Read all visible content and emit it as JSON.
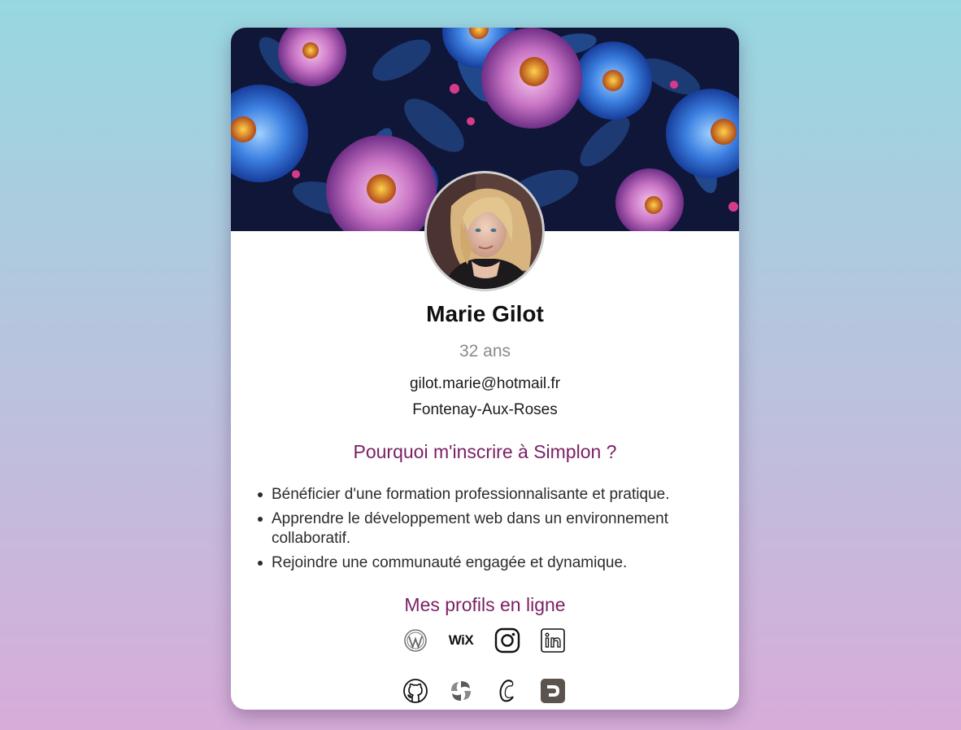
{
  "profile": {
    "name": "Marie Gilot",
    "age": "32 ans",
    "email": "gilot.marie@hotmail.fr",
    "city": "Fontenay-Aux-Roses"
  },
  "why": {
    "title": "Pourquoi m'inscrire à Simplon ?",
    "items": [
      "Bénéficier d'une formation professionnalisante et pratique.",
      "Apprendre le développement web dans un environnement collaboratif.",
      "Rejoindre une communauté engagée et dynamique."
    ]
  },
  "profiles": {
    "title": "Mes profils en ligne",
    "wix_label": "WiX",
    "icons": [
      "wordpress-icon",
      "wix-icon",
      "instagram-icon",
      "linkedin-icon",
      "github-icon",
      "sourcetree-icon",
      "codepen-icon",
      "dribbble-d-icon"
    ]
  },
  "colors": {
    "heading_accent": "#7a1f63",
    "bg_top": "#97d8e0",
    "bg_bottom": "#d7acd9"
  }
}
